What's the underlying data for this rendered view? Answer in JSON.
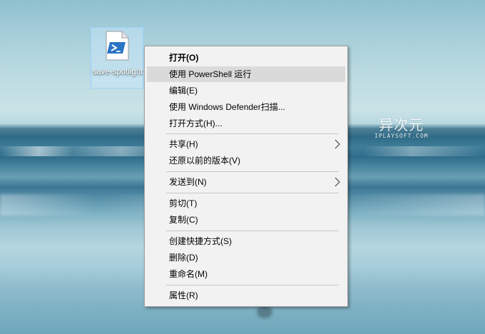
{
  "desktop_icon": {
    "label": "save-spotlight",
    "icon": "powershell-file-icon"
  },
  "watermark": {
    "main": "异次元",
    "sub": "IPLAYSOFT.COM"
  },
  "context_menu": {
    "items": [
      {
        "label": "打开(O)",
        "bold": true
      },
      {
        "label": "使用 PowerShell 运行",
        "highlighted": true
      },
      {
        "label": "编辑(E)"
      },
      {
        "label": "使用 Windows Defender扫描..."
      },
      {
        "label": "打开方式(H)..."
      },
      {
        "label": "共享(H)",
        "submenu": true
      },
      {
        "label": "还原以前的版本(V)"
      },
      {
        "label": "发送到(N)",
        "submenu": true
      },
      {
        "label": "剪切(T)"
      },
      {
        "label": "复制(C)"
      },
      {
        "label": "创建快捷方式(S)"
      },
      {
        "label": "删除(D)"
      },
      {
        "label": "重命名(M)"
      },
      {
        "label": "属性(R)"
      }
    ]
  },
  "colors": {
    "menu_bg": "#f2f2f2",
    "highlight": "#dadada",
    "separator": "#c8c8c8",
    "icon_selection": "#cce8ff"
  }
}
